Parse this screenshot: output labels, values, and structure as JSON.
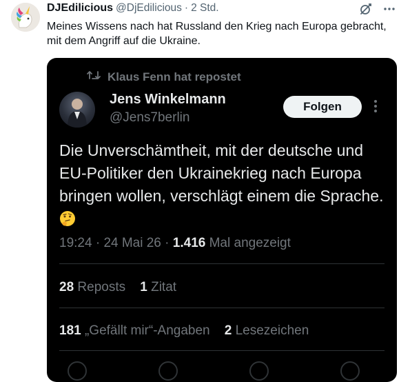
{
  "post": {
    "display_name": "DJEdilicious",
    "handle": "@DjEdilicious",
    "separator": "·",
    "time": "2 Std.",
    "text": "Meines Wissens nach hat Russland den Krieg nach Europa gebracht, mit dem Angriff auf die Ukraine.",
    "icons": [
      "grok-icon",
      "more-icon"
    ]
  },
  "embedded": {
    "repost_label": "Klaus Fenn hat repostet",
    "display_name": "Jens Winkelmann",
    "handle": "@Jens7berlin",
    "follow_label": "Folgen",
    "text": "Die Unverschämtheit, mit der deutsche und EU-Politiker den Ukrainekrieg nach Europa bringen wollen, verschlägt einem die Sprache.",
    "emoji": "thinking-face",
    "time": "19:24",
    "date": "24 Mai 26",
    "views_count": "1.416",
    "views_label": "Mal angezeigt",
    "reposts_count": "28",
    "reposts_label": "Reposts",
    "quotes_count": "1",
    "quotes_label": "Zitat",
    "likes_count": "181",
    "likes_label": "„Gefällt mir“-Angaben",
    "bookmarks_count": "2",
    "bookmarks_label": "Lesezeichen",
    "colors": {
      "background": "#000000",
      "text": "#e7e9ea",
      "muted": "#71767b",
      "follow_bg": "#eff3f4"
    }
  }
}
